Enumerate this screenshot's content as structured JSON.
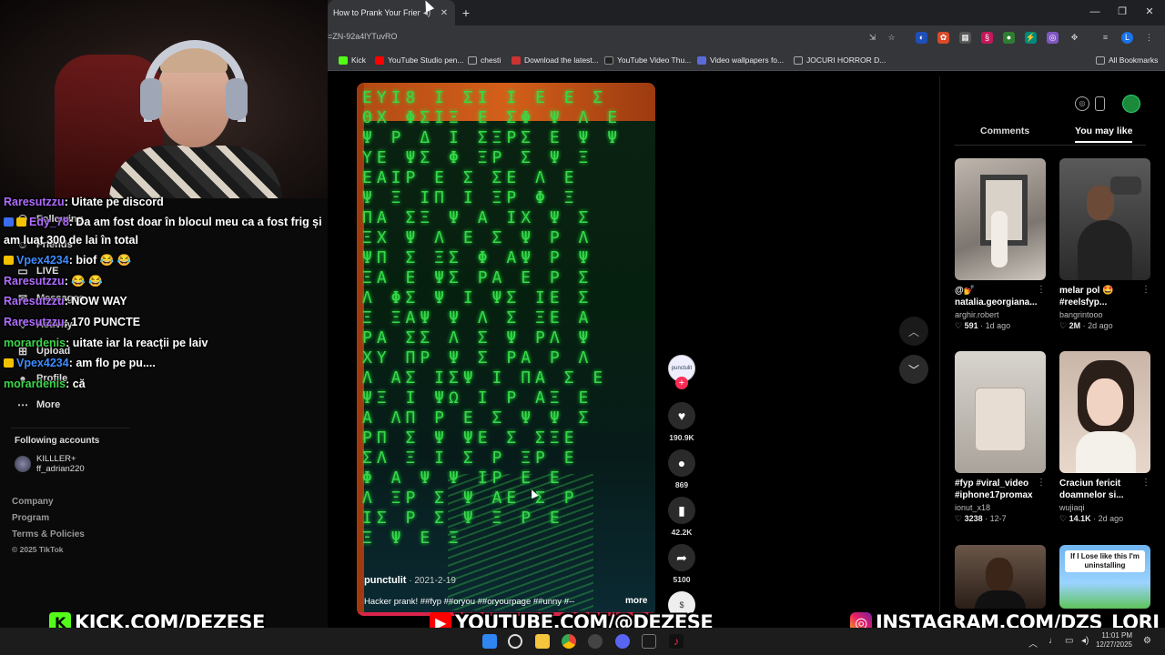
{
  "browser": {
    "tab_title": "How to Prank Your Friends",
    "url": "=ZN-92a4lYTuvRO",
    "bookmarks": [
      "Kick",
      "YouTube Studio pen...",
      "chesti",
      "Download the latest...",
      "YouTube Video Thu...",
      "Video wallpapers fo...",
      "JOCURI HORROR D..."
    ],
    "all_bookmarks": "All Bookmarks"
  },
  "sidebar": {
    "items": [
      {
        "label": "Following",
        "icon": "following-icon"
      },
      {
        "label": "Friends",
        "icon": "friends-icon"
      },
      {
        "label": "LIVE",
        "icon": "live-icon"
      },
      {
        "label": "Messages",
        "icon": "messages-icon"
      },
      {
        "label": "Activity",
        "icon": "activity-icon"
      },
      {
        "label": "Upload",
        "icon": "upload-icon"
      },
      {
        "label": "Profile",
        "icon": "profile-icon"
      },
      {
        "label": "More",
        "icon": "more-icon"
      }
    ],
    "following_accounts_label": "Following accounts",
    "account": {
      "name": "KILLLER+",
      "handle": "ff_adrian220"
    },
    "footer": [
      "Company",
      "Program",
      "Terms & Policies"
    ],
    "copyright": "© 2025 TikTok"
  },
  "chat": [
    {
      "user": "Raresutzzu",
      "text": ": Uitate pe discord",
      "color": "#b06cff",
      "badge": false
    },
    {
      "user": "Edy_78",
      "text": ": Da am fost doar în blocul meu ca a fost frig și am luat 300 de lai în total",
      "color": "#b06cff",
      "badge": true
    },
    {
      "user": "Vpex4234",
      "text": ": biof 😂 😂",
      "color": "#3c8cff",
      "badge": true
    },
    {
      "user": "Raresutzzu",
      "text": ": 😂 😂",
      "color": "#b06cff",
      "badge": false
    },
    {
      "user": "Raresutzzu",
      "text": ": NOW WAY",
      "color": "#b06cff",
      "badge": false
    },
    {
      "user": "Raresutzzu",
      "text": ": 170 PUNCTE",
      "color": "#b06cff",
      "badge": false
    },
    {
      "user": "morardenis",
      "text": ": uitate iar la reacții pe laiv",
      "color": "#3cd64a",
      "badge": false
    },
    {
      "user": "Vpex4234",
      "text": ": am flo pe pu....",
      "color": "#3c8cff",
      "badge": true
    },
    {
      "user": "morardenis",
      "text": ": că",
      "color": "#3cd64a",
      "badge": false
    }
  ],
  "video": {
    "author": "punctulit",
    "date": "2021-2-19",
    "caption": "Hacker prank! ##fyp ##oryou ##oryourpage ##unny #--",
    "more": "more",
    "likes": "190.9K",
    "comments": "869",
    "saves": "42.2K",
    "shares": "5100",
    "avatar_text": "punctulit"
  },
  "panel": {
    "tabs": [
      "Comments",
      "You may like"
    ],
    "cards": [
      {
        "title": "@💅 natalia.georgiana...",
        "user": "arghir.robert",
        "views": "591",
        "age": "1d ago"
      },
      {
        "title": "melar pol 🤩 #reelsfyp...",
        "user": "bangrintooo",
        "views": "2M",
        "age": "2d ago"
      },
      {
        "title": "#fyp #viral_video #iphone17promax",
        "user": "ionut_x18",
        "views": "3238",
        "age": "12-7"
      },
      {
        "title": "Craciun fericit doamnelor si...",
        "user": "wujiaqi",
        "views": "14.1K",
        "age": "2d ago"
      },
      {
        "title": "",
        "user": "",
        "views": "",
        "age": ""
      },
      {
        "title": "If I Lose like this I'm uninstalling",
        "user": "",
        "views": "",
        "age": ""
      }
    ]
  },
  "banners": {
    "kick": "KICK.COM/DEZESE",
    "youtube": "YOUTUBE.COM/@DEZESE",
    "instagram": "INSTAGRAM.COM/DZS_LORI"
  },
  "taskbar": {
    "time": "11:01 PM",
    "date": "12/27/2025"
  },
  "colors": {
    "accent": "#fe2c55",
    "kick": "#53fc18",
    "youtube": "#ff0000",
    "matrix": "#38d84a"
  }
}
